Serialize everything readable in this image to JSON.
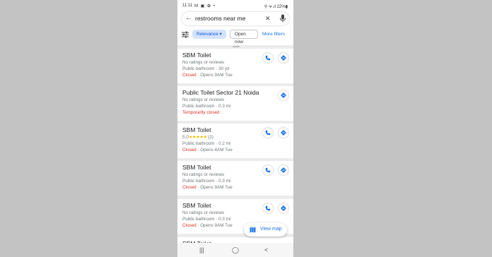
{
  "status_bar": {
    "time": "11:11",
    "left_icons": "M ▣ ✿ •",
    "right_text": "⚲ ᯤ.ıl 22%▮"
  },
  "search": {
    "query": "restrooms near me"
  },
  "filters": {
    "relevance": "Relevance ▾",
    "open_now": "Open now",
    "more_filters": "More filters"
  },
  "results": [
    {
      "name": "SBM Toilet",
      "line2": "No ratings or reviews",
      "line3": "Public bathroom · 30 yd",
      "status": "Closed",
      "extra": " · Opens 9AM Tue",
      "has_call": true
    },
    {
      "name": "Public Toilet Sector 21 Noida",
      "line2": "No ratings or reviews",
      "line3": "Public bathroom · 0.3 mi",
      "status": "Temporarily closed",
      "extra": "",
      "has_call": false
    },
    {
      "name": "SBM Toilet",
      "rating": "5.0",
      "stars": "★★★★★",
      "reviews": "(2)",
      "line3": "Public bathroom · 0.2 mi",
      "status": "Closed",
      "extra": " · Opens 4AM Tue",
      "has_call": true
    },
    {
      "name": "SBM Toilet",
      "line2": "No ratings or reviews",
      "line3": "Public bathroom · 0.3 mi",
      "status": "Closed",
      "extra": " · Opens 9AM Tue",
      "has_call": true
    },
    {
      "name": "SBM Toilet",
      "line2": "No ratings or reviews",
      "line3": "Public bathroom · 0.3 mi",
      "status": "Closed",
      "extra": " · Opens 9AM Tue",
      "has_call": true
    },
    {
      "name": "SBM Toilet"
    }
  ],
  "view_map_label": "View map",
  "nav": {
    "recents": "|||",
    "home": "◯",
    "back": "<"
  },
  "colors": {
    "accent": "#1a73e8",
    "closed": "#d93025",
    "chip_bg": "#d3e3fd",
    "star": "#fbbc04"
  }
}
